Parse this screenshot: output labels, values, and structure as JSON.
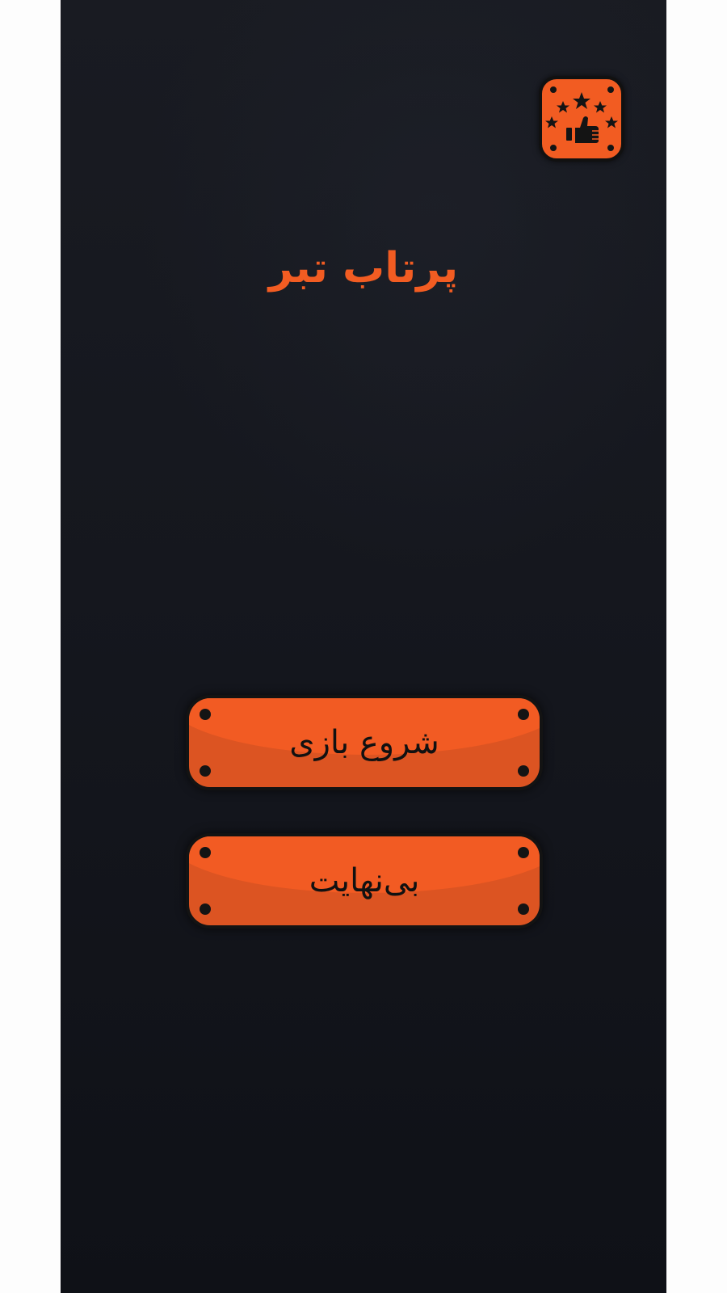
{
  "rate_button": {
    "icon": "rate-stars-thumbs-up-icon",
    "color": "#f25c22"
  },
  "title": "پرتاب تبر",
  "menu": {
    "start_label": "شروع بازی",
    "endless_label": "بی‌نهایت"
  },
  "colors": {
    "accent": "#f25c22",
    "button_base": "#dc5422",
    "background": "#15171e"
  }
}
